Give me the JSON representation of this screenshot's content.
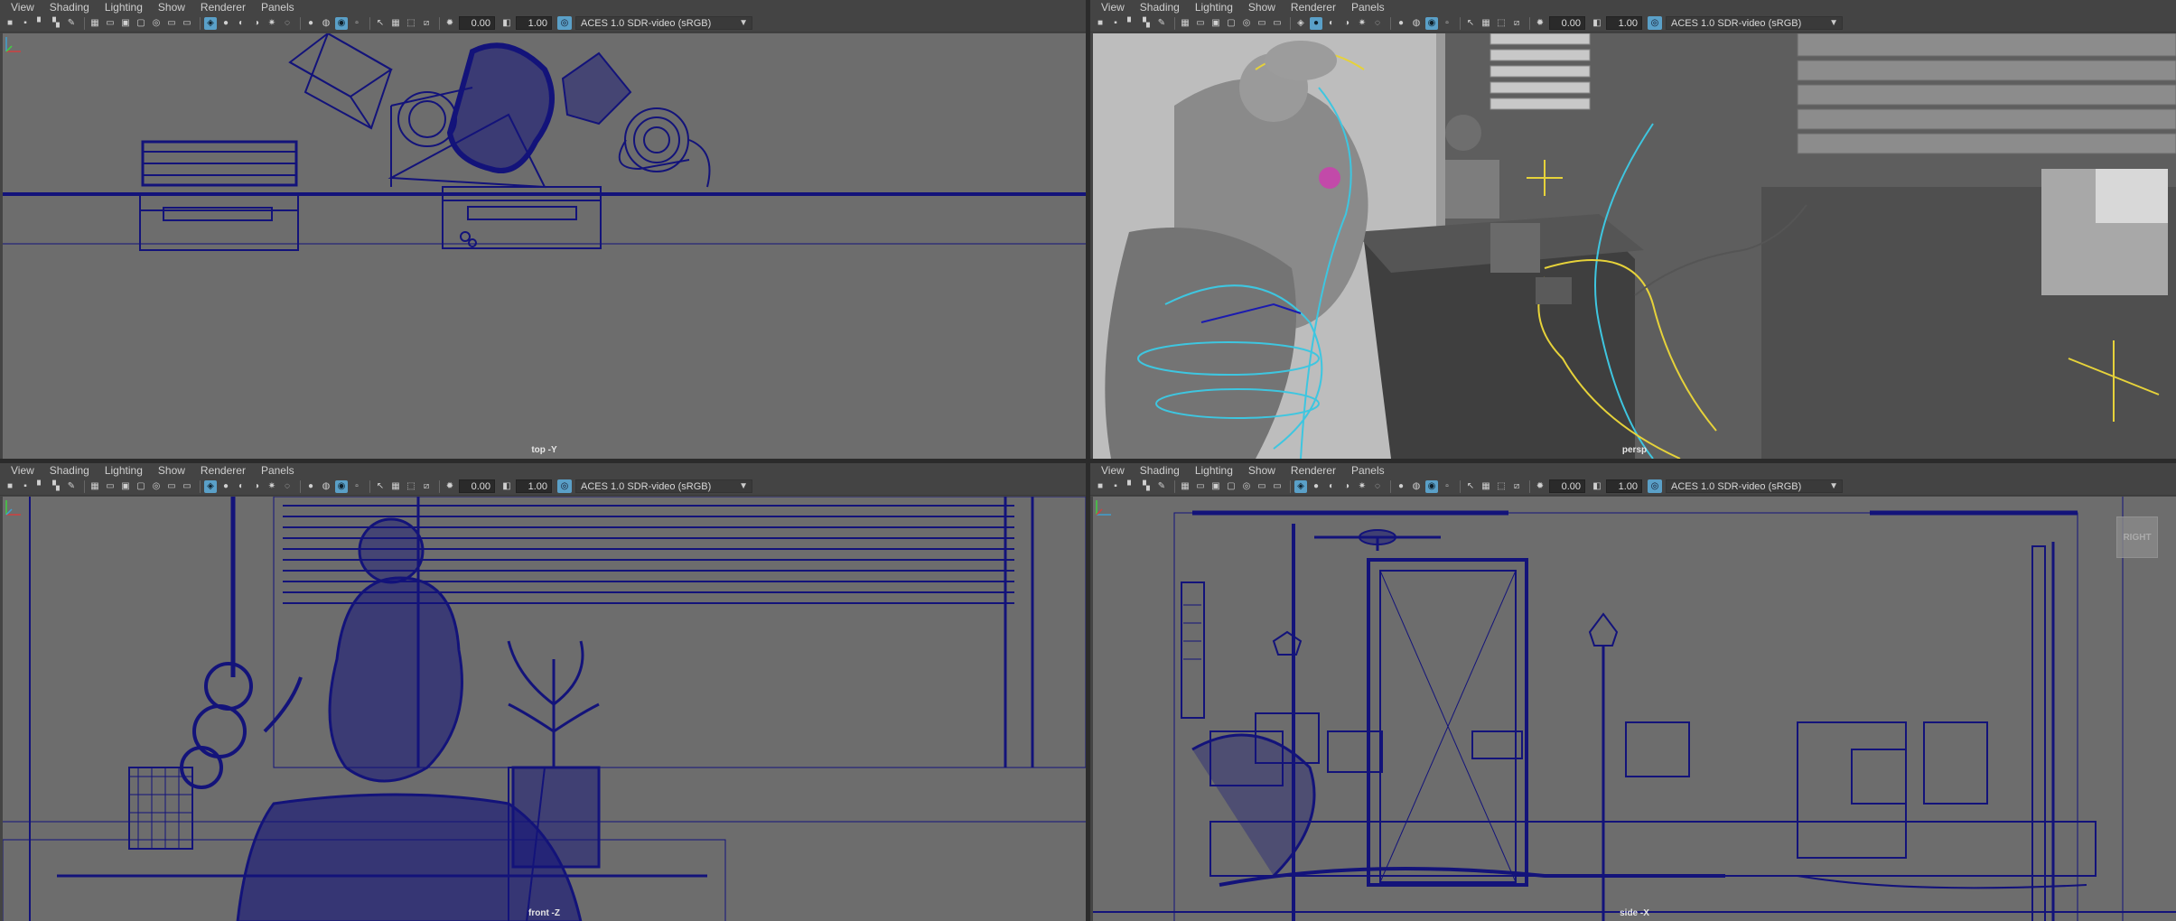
{
  "menu": [
    "View",
    "Shading",
    "Lighting",
    "Show",
    "Renderer",
    "Panels"
  ],
  "toolbar": {
    "exposure": "0.00",
    "gamma": "1.00",
    "color_management": "ACES 1.0 SDR-video (sRGB)"
  },
  "panels": [
    {
      "camera": "top -Y"
    },
    {
      "camera": "persp"
    },
    {
      "camera": "front -Z"
    },
    {
      "camera": "side -X",
      "viewcube": "RIGHT"
    }
  ],
  "colors": {
    "wire": "#13137a",
    "viewport_bg": "#6d6d6d",
    "highlight": "#5aa0c8",
    "curve_yellow": "#e6d23a",
    "curve_cyan": "#3ec6e0"
  }
}
